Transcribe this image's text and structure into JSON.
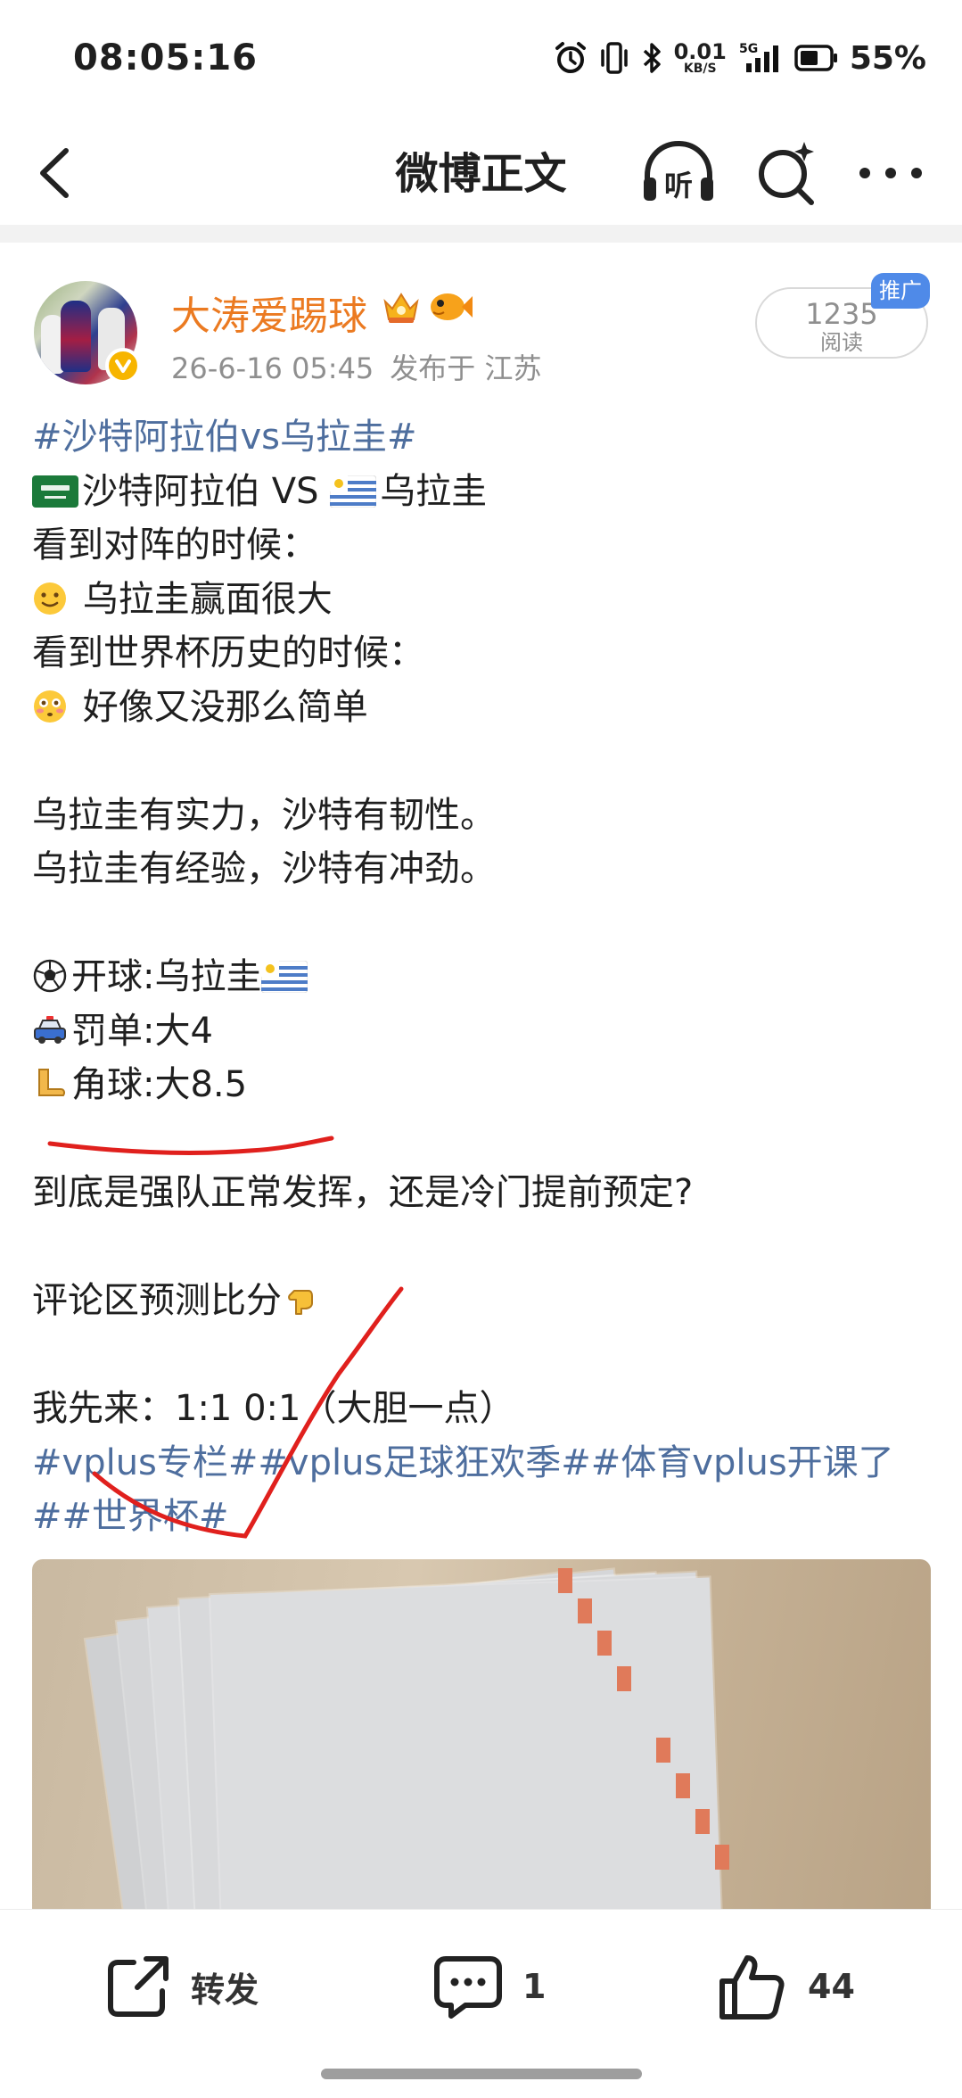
{
  "status_bar": {
    "time": "08:05:16",
    "net_speed_value": "0.01",
    "net_speed_unit": "KB/S",
    "network": "5G",
    "battery_percent": "55%",
    "icons": [
      "alarm-icon",
      "vibrate-icon",
      "bluetooth-icon",
      "signal-icon",
      "battery-icon"
    ]
  },
  "nav": {
    "title": "微博正文",
    "listen_label": "听",
    "icons": [
      "back-arrow-icon",
      "headphones-listen-icon",
      "search-icon",
      "more-icon"
    ]
  },
  "author": {
    "name": "大涛爱踢球",
    "time": "26-6-16 05:45",
    "location": "发布于 江苏",
    "badges": [
      "crown-badge-icon",
      "fish-badge-icon",
      "verified-icon"
    ]
  },
  "read_stats": {
    "count": "1235",
    "label": "阅读",
    "promo_tag": "推广"
  },
  "post": {
    "title_tag": "#沙特阿拉伯vs乌拉圭#",
    "matchup_text": "沙特阿拉伯 VS ",
    "matchup_team2": "乌拉圭",
    "l_lineup_intro": "看到对阵的时候：",
    "l_lineup_view": " 乌拉圭赢面很大",
    "l_history_intro": "看到世界杯历史的时候：",
    "l_history_view": " 好像又没那么简单",
    "l_strength": "乌拉圭有实力，沙特有韧性。",
    "l_experience": "乌拉圭有经验，沙特有冲劲。",
    "l_kickoff": "开球:乌拉圭",
    "l_cards": "罚单:大4",
    "l_corners": "角球:大8.5",
    "l_question": "到底是强队正常发挥，还是冷门提前预定?",
    "l_comment_prompt": "评论区预测比分",
    "l_my_pick": "我先来：1:1  0:1（大胆一点）",
    "tags_line1": "#vplus专栏##vplus足球狂欢季##体育vplus开课了",
    "tags_line2": "##世界杯#",
    "emoji_icons": [
      "saudi-flag-icon",
      "uruguay-flag-icon",
      "slight-smile-icon",
      "flushed-face-icon",
      "soccer-ball-icon",
      "police-car-icon",
      "foot-icon",
      "pointing-down-icon"
    ]
  },
  "actions": {
    "repost_label": "转发",
    "comment_count": "1",
    "like_count": "44"
  },
  "colors": {
    "username": "#eb7a21",
    "tag_link": "#4e6e9e",
    "promo": "#4f8ae8",
    "ink": "#e0201d"
  }
}
